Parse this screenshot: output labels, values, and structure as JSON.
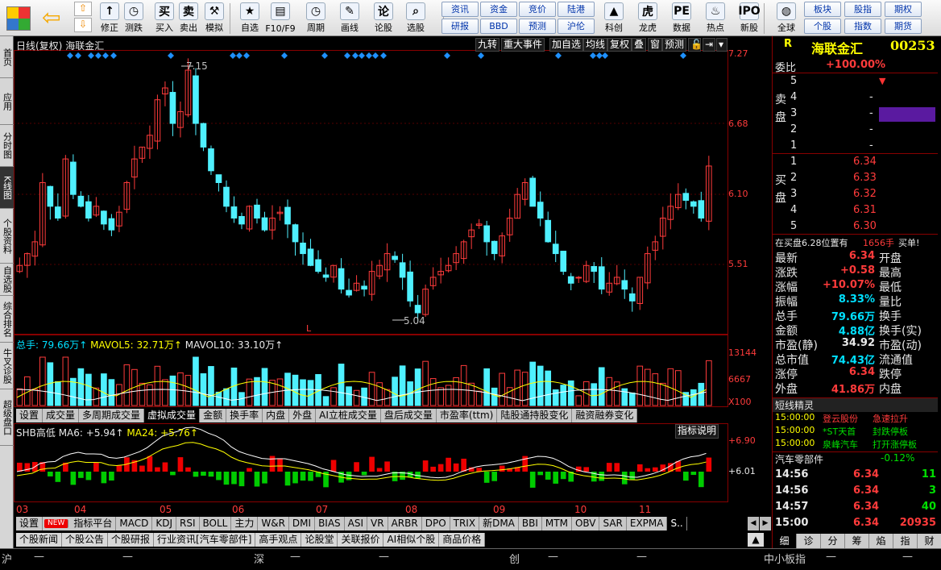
{
  "toolbar": {
    "buttons": [
      {
        "label": "修正",
        "icon": "↑"
      },
      {
        "label": "测跌",
        "icon": "◷"
      },
      {
        "label": "买入",
        "icon": "买"
      },
      {
        "label": "卖出",
        "icon": "卖"
      },
      {
        "label": "模拟",
        "icon": "⚒"
      },
      {
        "label": "自选",
        "icon": "★"
      },
      {
        "label": "F10/F9",
        "icon": "▤"
      },
      {
        "label": "周期",
        "icon": "◷"
      },
      {
        "label": "画线",
        "icon": "✎"
      },
      {
        "label": "论股",
        "icon": "论"
      },
      {
        "label": "选股",
        "icon": "⌕"
      },
      {
        "label": "科创",
        "icon": "▲"
      },
      {
        "label": "龙虎",
        "icon": "虎"
      },
      {
        "label": "数据",
        "icon": "PE"
      },
      {
        "label": "热点",
        "icon": "♨"
      },
      {
        "label": "新股",
        "icon": "IPO"
      },
      {
        "label": "全球",
        "icon": "◍"
      }
    ],
    "small": [
      "资讯",
      "资金",
      "竞价",
      "陆港",
      "研报",
      "BBD",
      "预测",
      "沪伦",
      "板块",
      "股指",
      "期权",
      "个股",
      "指数",
      "期货"
    ]
  },
  "lefttabs": [
    "首页",
    "应用",
    "分时图",
    "K线图",
    "个股资料",
    "自选股",
    "综合排名",
    "牛叉诊股",
    "超级盘口"
  ],
  "chart": {
    "period_label": "日线(复权)",
    "stock_name": "海联金汇",
    "top_buttons": [
      "九转",
      "重大事件",
      "加自选",
      "均线",
      "复权",
      "叠",
      "窗",
      "预测"
    ],
    "price_axis": [
      "7.27",
      "6.68",
      "6.10",
      "5.51"
    ],
    "high_mark": "7.15",
    "low_mark": "5.04",
    "l_mark": "L",
    "vol_title": "总手: 79.66万↑",
    "mavol5": "MAVOL5: 32.71万↑",
    "mavol10": "MAVOL10: 33.10万↑",
    "vol_axis": [
      "13144",
      "6667",
      "X100"
    ],
    "vol_tabs": [
      "设置",
      "成交量",
      "多周期成交量",
      "虚拟成交量",
      "金额",
      "换手率",
      "内盘",
      "外盘",
      "AI立桩成交量",
      "盘后成交量",
      "市盈率(ttm)",
      "陆股通持股变化",
      "融资融券变化"
    ],
    "vol_tab_active": "虚拟成交量",
    "ind_title": "SHB高低",
    "ma6": "MA6: +5.94↑",
    "ma24": "MA24: +5.76↑",
    "ind_help": "指标说明",
    "ind_axis": [
      "+6.90",
      "+6.01"
    ],
    "months": [
      "03",
      "04",
      "05",
      "06",
      "07",
      "08",
      "09",
      "10",
      "11"
    ],
    "ind_tabs": [
      "设置",
      "NEW",
      "指标平台",
      "MACD",
      "KDJ",
      "RSI",
      "BOLL",
      "主力",
      "W&R",
      "DMI",
      "BIAS",
      "ASI",
      "VR",
      "ARBR",
      "DPO",
      "TRIX",
      "新DMA",
      "BBI",
      "MTM",
      "OBV",
      "SAR",
      "EXPMA",
      "S.."
    ],
    "news_tabs": [
      "个股新闻",
      "个股公告",
      "个股研报",
      "行业资讯[汽车零部件]",
      "高手观点",
      "论股堂",
      "关联报价",
      "AI相似个股",
      "商品价格"
    ]
  },
  "chart_data": {
    "type": "candlestick",
    "series_desc": "daily K-line approx",
    "price_range": [
      4.8,
      7.3
    ],
    "closes": [
      5.5,
      5.6,
      5.7,
      6.2,
      6.0,
      5.9,
      6.4,
      6.1,
      6.0,
      5.9,
      6.0,
      5.85,
      5.8,
      5.95,
      6.2,
      6.4,
      6.5,
      6.6,
      6.9,
      7.0,
      6.7,
      6.8,
      7.15,
      6.7,
      6.5,
      6.3,
      6.2,
      6.0,
      5.9,
      5.85,
      6.0,
      5.9,
      5.8,
      5.9,
      5.95,
      5.85,
      5.7,
      5.6,
      5.5,
      5.45,
      5.4,
      5.5,
      5.3,
      5.25,
      5.35,
      5.3,
      5.45,
      5.5,
      5.6,
      5.55,
      5.4,
      5.2,
      5.1,
      5.3,
      5.4,
      5.45,
      5.5,
      5.6,
      5.7,
      5.8,
      5.85,
      5.7,
      5.6,
      5.75,
      5.9,
      6.1,
      6.2,
      6.0,
      5.9,
      5.7,
      5.6,
      5.45,
      5.35,
      5.4,
      5.5,
      5.45,
      5.3,
      5.35,
      5.4,
      5.3,
      5.2,
      5.4,
      5.6,
      5.7,
      5.9,
      6.0,
      6.1,
      6.05,
      6.0,
      5.9,
      6.34
    ]
  },
  "quote": {
    "code_label": "R",
    "name": "海联金汇",
    "code": "00253",
    "weibi_label": "委比",
    "weibi": "+100.00%",
    "sell_label": "卖盘",
    "buy_label": "买盘",
    "sell": [
      {
        "n": "5",
        "p": "",
        "v": ""
      },
      {
        "n": "4",
        "p": "",
        "v": "-"
      },
      {
        "n": "3",
        "p": "",
        "v": "-"
      },
      {
        "n": "2",
        "p": "",
        "v": "-"
      },
      {
        "n": "1",
        "p": "",
        "v": "-"
      }
    ],
    "buy": [
      {
        "n": "1",
        "p": "6.34",
        "v": ""
      },
      {
        "n": "2",
        "p": "6.33",
        "v": ""
      },
      {
        "n": "3",
        "p": "6.32",
        "v": ""
      },
      {
        "n": "4",
        "p": "6.31",
        "v": ""
      },
      {
        "n": "5",
        "p": "6.30",
        "v": ""
      }
    ],
    "notice": "在买盘6.28位置有",
    "notice_vol": "1656手",
    "notice_tail": "买单!",
    "fields": [
      {
        "l": "最新",
        "v": "6.34",
        "c": "red",
        "l2": "开盘"
      },
      {
        "l": "涨跌",
        "v": "+0.58",
        "c": "red",
        "l2": "最高"
      },
      {
        "l": "涨幅",
        "v": "+10.07%",
        "c": "red",
        "l2": "最低"
      },
      {
        "l": "振幅",
        "v": "8.33%",
        "c": "cyan",
        "l2": "量比"
      },
      {
        "l": "总手",
        "v": "79.66万",
        "c": "cyan",
        "l2": "换手"
      },
      {
        "l": "金额",
        "v": "4.88亿",
        "c": "cyan",
        "l2": "换手(实)"
      },
      {
        "l": "市盈(静)",
        "v": "34.92",
        "c": "white",
        "l2": "市盈(动)"
      },
      {
        "l": "总市值",
        "v": "74.43亿",
        "c": "cyan",
        "l2": "流通值"
      },
      {
        "l": "涨停",
        "v": "6.34",
        "c": "red",
        "l2": "跌停"
      },
      {
        "l": "外盘",
        "v": "41.86万",
        "c": "red",
        "l2": "内盘"
      }
    ],
    "spirit_title": "短线精灵",
    "spirit": [
      {
        "t": "15:00:00",
        "s": "登云股份",
        "e": "急速拉升",
        "c": "red"
      },
      {
        "t": "15:00:00",
        "s": "*ST天首",
        "e": "封跌停板",
        "c": "green"
      },
      {
        "t": "15:00:00",
        "s": "泉峰汽车",
        "e": "打开涨停板",
        "c": "green"
      }
    ],
    "sector": "汽车零部件",
    "sector_chg": "-0.12%",
    "ticks": [
      {
        "t": "14:56",
        "p": "6.34",
        "v": "11",
        "c": "green"
      },
      {
        "t": "14:56",
        "p": "6.34",
        "v": "3",
        "c": "green"
      },
      {
        "t": "14:57",
        "p": "6.34",
        "v": "40",
        "c": "green"
      },
      {
        "t": "15:00",
        "p": "6.34",
        "v": "20935",
        "c": "red"
      }
    ],
    "bottom_tabs": [
      "细",
      "诊",
      "分",
      "筹",
      "焰",
      "指",
      "财"
    ]
  },
  "status": {
    "sh": "沪",
    "sz": "深",
    "cy": "创",
    "zxb": "中小板指",
    "dash": "—"
  }
}
